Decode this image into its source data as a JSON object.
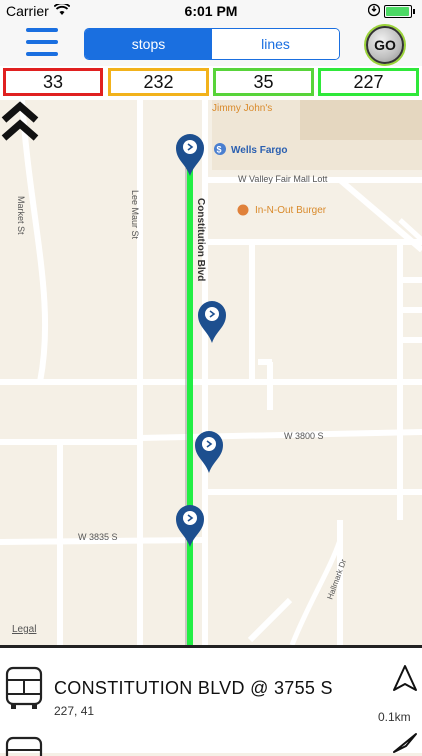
{
  "status": {
    "carrier": "Carrier",
    "time": "6:01 PM",
    "battery_fraction": 0.95
  },
  "nav": {
    "tabs": [
      {
        "label": "stops",
        "active": true
      },
      {
        "label": "lines",
        "active": false
      }
    ],
    "go_label": "GO"
  },
  "routes": [
    {
      "number": "33",
      "color": "#e02020"
    },
    {
      "number": "232",
      "color": "#f2b21b"
    },
    {
      "number": "35",
      "color": "#58d43a"
    },
    {
      "number": "227",
      "color": "#2fe83a"
    }
  ],
  "map": {
    "labels": {
      "jimmy": "Jimmy John's",
      "wells": "Wells Fargo",
      "valley": "W Valley Fair Mall Lott",
      "innout": "In-N-Out Burger",
      "market": "Market St",
      "leemaur": "Lee Maur St",
      "constitution": "Constitution Blvd",
      "w3800": "W 3800 S",
      "w3835": "W 3835 S",
      "hallmark": "Hallmark Dr"
    },
    "legal": "Legal",
    "route_color": "#22ee44",
    "pin_color": "#1d4f8f"
  },
  "stop": {
    "name": "CONSTITUTION BLVD @ 3755 S",
    "routes": "227, 41",
    "distance": "0.1km"
  }
}
